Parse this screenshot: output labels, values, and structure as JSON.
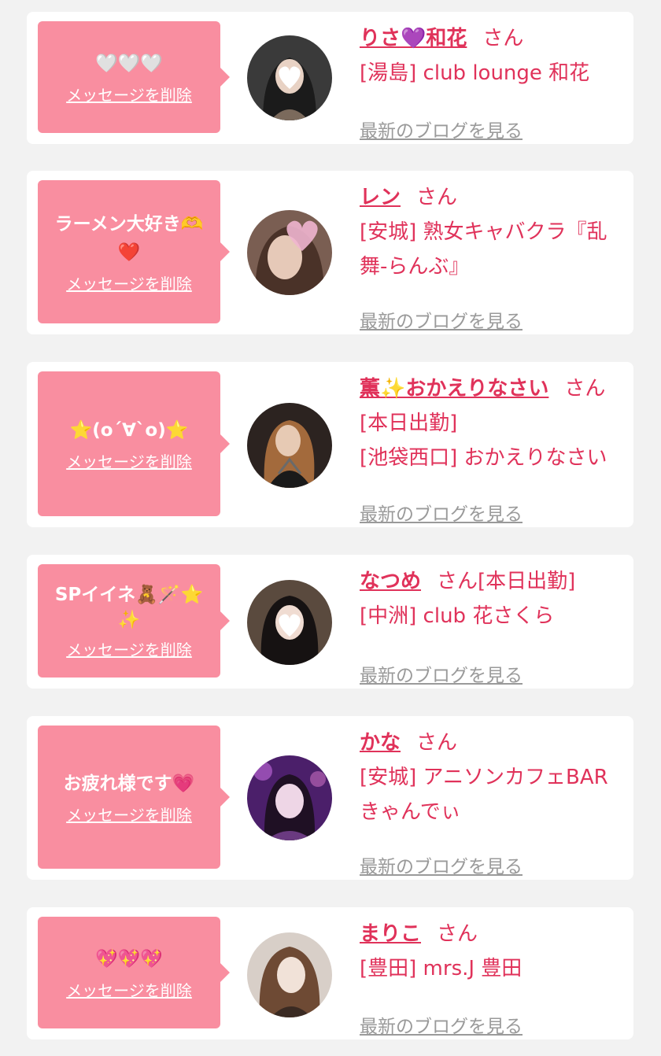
{
  "delete_label": "メッセージを削除",
  "blog_label": "最新のブログを見る",
  "san_label": "さん",
  "colors": {
    "bubble": "#f98ea0",
    "name": "#e0325a",
    "link_gray": "#9a9a9a"
  },
  "messages": [
    {
      "bubble": "🤍🤍🤍",
      "name": "りさ💜和花",
      "suffix": "",
      "shop": "[湯島] club lounge 和花"
    },
    {
      "bubble": "ラーメン大好き🫶❤️",
      "name": "レン",
      "suffix": "",
      "shop": "[安城] 熟女キャバクラ『乱舞-らんぶ』"
    },
    {
      "bubble": "⭐(o´∀`o)⭐",
      "name": "薫✨おかえりなさい",
      "suffix": "[本日出勤]",
      "shop": "[池袋西口] おかえりなさい"
    },
    {
      "bubble": "SPイイネ🧸🪄⭐✨",
      "name": "なつめ",
      "suffix": "[本日出勤]",
      "shop": "[中洲] club 花さくら"
    },
    {
      "bubble": "お疲れ様です💗",
      "name": "かな",
      "suffix": "",
      "shop": "[安城] アニソンカフェBAR きゃんでぃ"
    },
    {
      "bubble": "💖💖💖",
      "name": "まりこ",
      "suffix": "",
      "shop": "[豊田] mrs.J 豊田"
    }
  ]
}
